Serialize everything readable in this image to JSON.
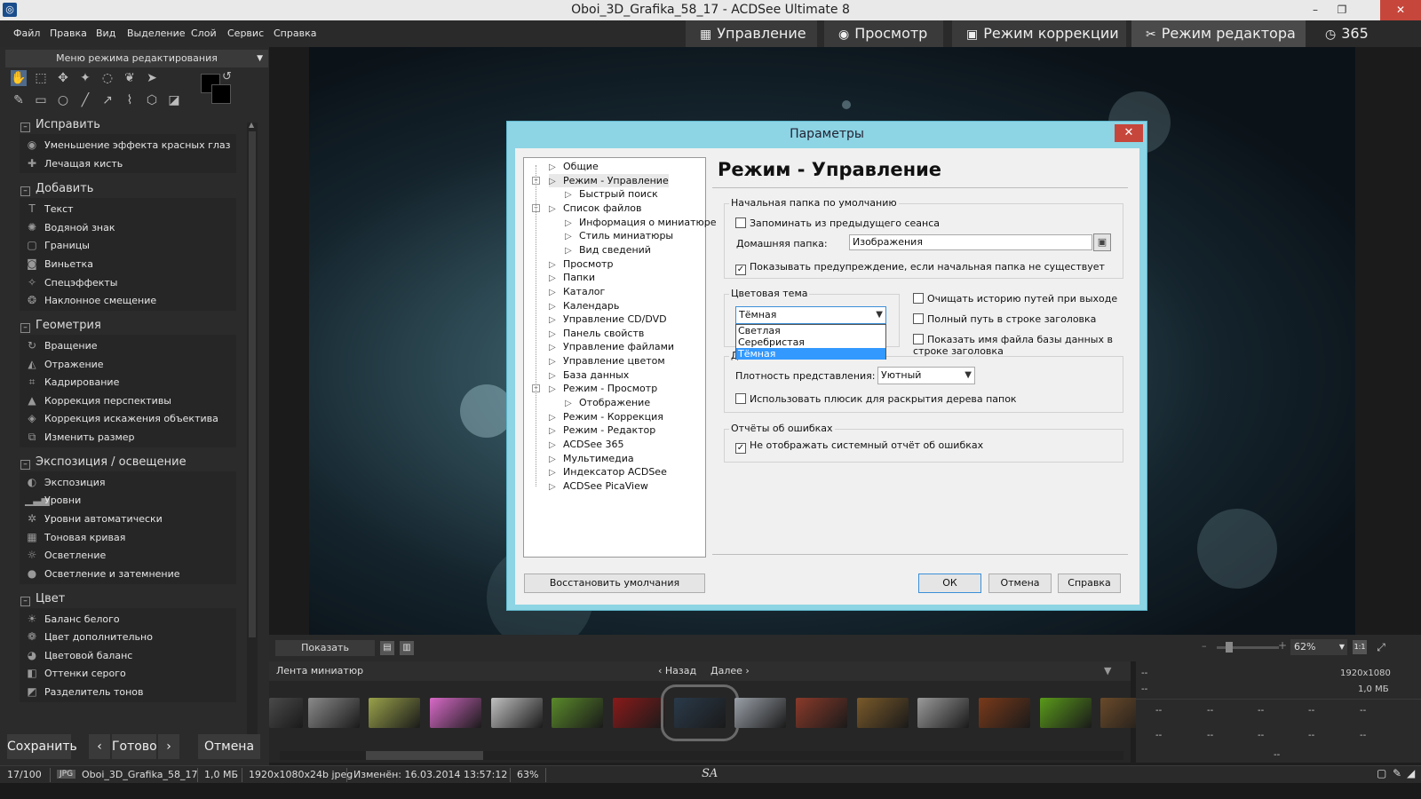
{
  "window": {
    "title": "Oboi_3D_Grafika_58_17 - ACDSee Ultimate 8",
    "minimize": "–",
    "restore": "❐",
    "close": "✕"
  },
  "menu": [
    "Файл",
    "Правка",
    "Вид",
    "Выделение",
    "Слой",
    "Сервис",
    "Справка"
  ],
  "modes": [
    {
      "label": "Управление",
      "icon": "grid"
    },
    {
      "label": "Просмотр",
      "icon": "eye"
    },
    {
      "label": "Режим коррекции",
      "icon": "image"
    },
    {
      "label": "Режим редактора",
      "icon": "tools"
    },
    {
      "label": "365",
      "icon": "365"
    }
  ],
  "left_panel": {
    "mode_menu": "Меню режима редактирования",
    "sections": [
      {
        "title": "Исправить",
        "items": [
          "Уменьшение эффекта красных глаз",
          "Лечащая кисть"
        ]
      },
      {
        "title": "Добавить",
        "items": [
          "Текст",
          "Водяной знак",
          "Границы",
          "Виньетка",
          "Спецэффекты",
          "Наклонное смещение"
        ]
      },
      {
        "title": "Геометрия",
        "items": [
          "Вращение",
          "Отражение",
          "Кадрирование",
          "Коррекция перспективы",
          "Коррекция искажения объектива",
          "Изменить размер"
        ]
      },
      {
        "title": "Экспозиция / освещение",
        "items": [
          "Экспозиция",
          "Уровни",
          "Уровни автоматически",
          "Тоновая кривая",
          "Осветление",
          "Осветление и затемнение"
        ]
      },
      {
        "title": "Цвет",
        "items": [
          "Баланс белого",
          "Цвет дополнительно",
          "Цветовой баланс",
          "Оттенки серого",
          "Разделитель тонов"
        ]
      }
    ],
    "buttons": {
      "save": "Сохранить",
      "prev": "‹",
      "done": "Готово",
      "next": "›",
      "cancel": "Отмена"
    }
  },
  "dialog": {
    "title": "Параметры",
    "close": "✕",
    "tree": [
      {
        "label": "Общие",
        "level": 0
      },
      {
        "label": "Режим - Управление",
        "level": 0,
        "expanded": true
      },
      {
        "label": "Быстрый поиск",
        "level": 1
      },
      {
        "label": "Список файлов",
        "level": 0,
        "expanded": true
      },
      {
        "label": "Информация о миниатюре",
        "level": 1
      },
      {
        "label": "Стиль миниатюры",
        "level": 1
      },
      {
        "label": "Вид сведений",
        "level": 1
      },
      {
        "label": "Просмотр",
        "level": 0
      },
      {
        "label": "Папки",
        "level": 0
      },
      {
        "label": "Каталог",
        "level": 0
      },
      {
        "label": "Календарь",
        "level": 0
      },
      {
        "label": "Управление CD/DVD",
        "level": 0
      },
      {
        "label": "Панель свойств",
        "level": 0
      },
      {
        "label": "Управление файлами",
        "level": 0
      },
      {
        "label": "Управление цветом",
        "level": 0
      },
      {
        "label": "База данных",
        "level": 0
      },
      {
        "label": "Режим - Просмотр",
        "level": 0,
        "expanded": true
      },
      {
        "label": "Отображение",
        "level": 1
      },
      {
        "label": "Режим - Коррекция",
        "level": 0
      },
      {
        "label": "Режим - Редактор",
        "level": 0
      },
      {
        "label": "ACDSee 365",
        "level": 0
      },
      {
        "label": "Мультимедиа",
        "level": 0
      },
      {
        "label": "Индексатор ACDSee",
        "level": 0
      },
      {
        "label": "ACDSee PicaView",
        "level": 0
      }
    ],
    "pane_title": "Режим - Управление",
    "group_start": "Начальная папка по умолчанию",
    "remember_session": {
      "label": "Запоминать из предыдущего сеанса",
      "checked": false
    },
    "home_label": "Домашняя папка:",
    "home_value": "Изображения",
    "warn_missing": {
      "label": "Показывать предупреждение, если начальная папка не существует",
      "checked": true
    },
    "group_theme": "Цветовая тема",
    "theme_value": "Тёмная",
    "theme_options": [
      "Светлая",
      "Серебристая",
      "Тёмная"
    ],
    "theme_selected_index": 2,
    "clear_history": {
      "label": "Очищать историю путей при выходе",
      "checked": false
    },
    "full_path": {
      "label": "Полный путь в строке заголовка",
      "checked": false
    },
    "show_db_name": {
      "label": "Показать имя файла базы данных в строке заголовка",
      "checked": false
    },
    "group_other_partial": "Д...",
    "density_label": "Плотность представления:",
    "density_value": "Уютный",
    "use_plus": {
      "label": "Использовать плюсик для раскрытия дерева папок",
      "checked": false
    },
    "group_errors": "Отчёты об ошибках",
    "no_error_report": {
      "label": "Не отображать системный отчёт об ошибках",
      "checked": true
    },
    "restore_defaults": "Восстановить умолчания",
    "ok": "ОК",
    "cancel": "Отмена",
    "help": "Справка"
  },
  "filmstrip": {
    "show_changes": "Показать изменения",
    "title": "Лента миниатюр",
    "back": "‹ Назад",
    "forward": "Далее ›",
    "zoom": "62%",
    "thumb_colors": [
      "#4a4a4a",
      "#8a8a8a",
      "#9aa24a",
      "#d86ac8",
      "#c0c0c0",
      "#5a8a2a",
      "#8a1a1a",
      "#2a3a4a",
      "#9aa0a8",
      "#8a3a2a",
      "#7a5a2a",
      "#9a9a9a",
      "#7a3a1a",
      "#5a9a1a",
      "#6a4a2a"
    ]
  },
  "info_panel": {
    "resolution": "1920x1080",
    "size": "1,0 МБ",
    "dash": "--"
  },
  "status": {
    "count": "17/100",
    "format": "JPG",
    "filename": "Oboi_3D_Grafika_58_17",
    "size": "1,0 МБ",
    "dims": "1920x1080x24b jpeg",
    "modified": "Изменён: 16.03.2014 13:57:12",
    "zoom": "63%",
    "sa": "SA"
  }
}
